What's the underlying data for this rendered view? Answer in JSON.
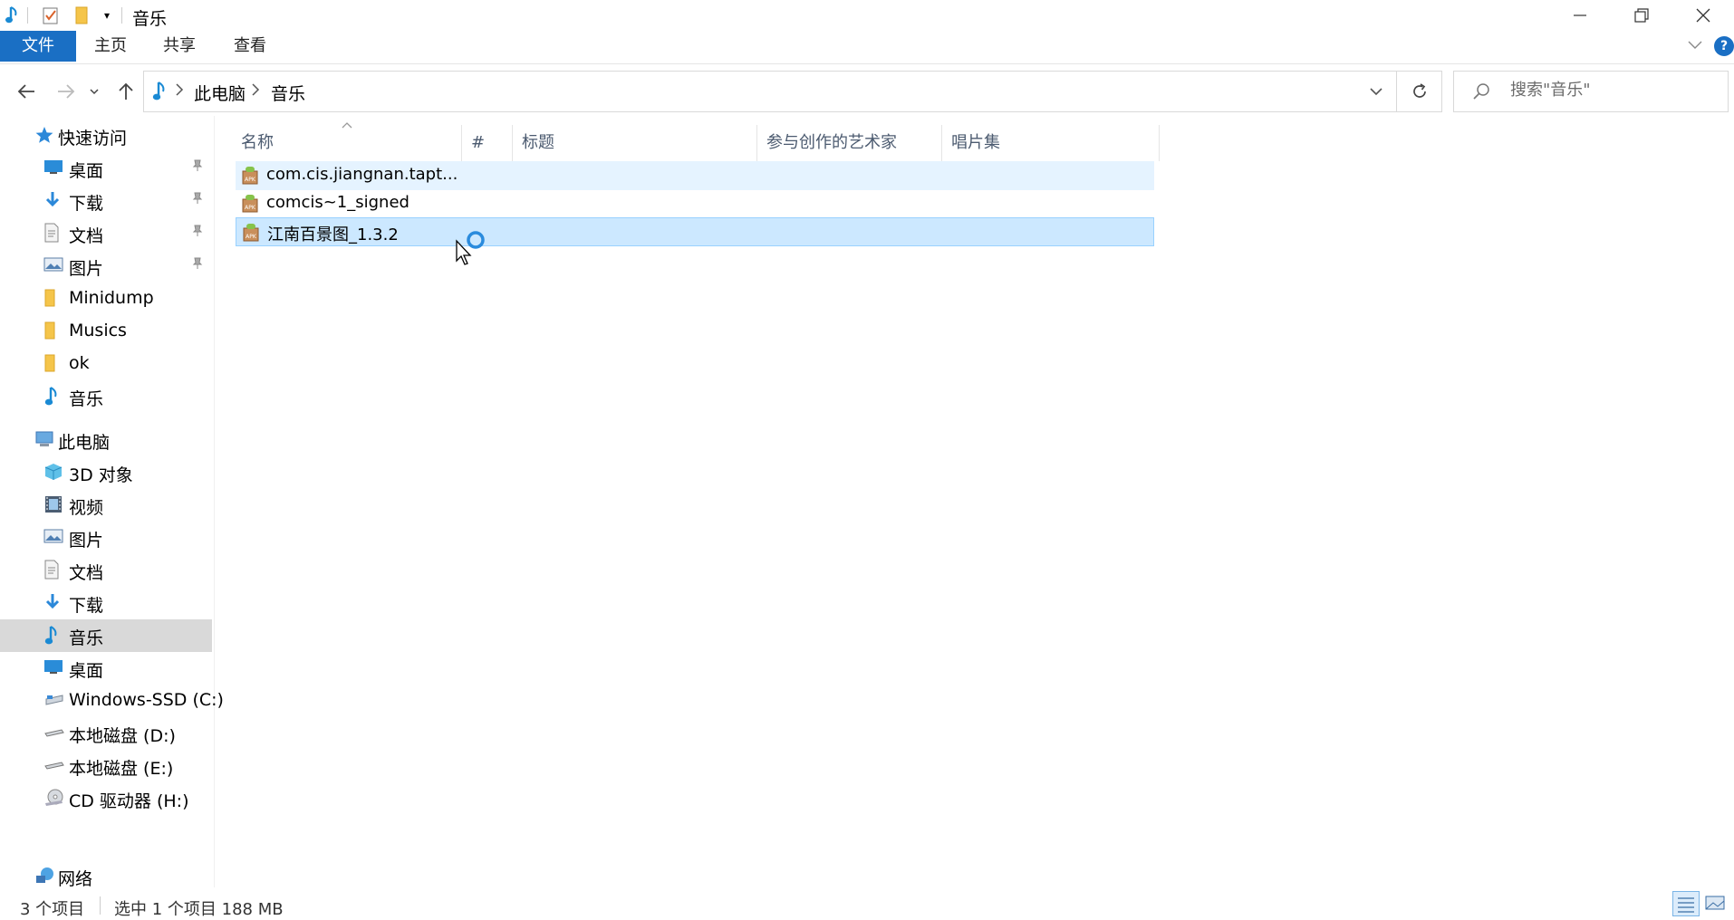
{
  "window": {
    "title": "音乐",
    "controls": [
      "minimize",
      "restore",
      "close"
    ]
  },
  "ribbon": {
    "tabs": [
      "文件",
      "主页",
      "共享",
      "查看"
    ]
  },
  "address": {
    "crumbs": [
      "此电脑",
      "音乐"
    ],
    "search_placeholder": "搜索\"音乐\""
  },
  "nav": {
    "quick_access": "快速访问",
    "quick_items": [
      {
        "label": "桌面",
        "pinned": true
      },
      {
        "label": "下载",
        "pinned": true
      },
      {
        "label": "文档",
        "pinned": true
      },
      {
        "label": "图片",
        "pinned": true
      },
      {
        "label": "Minidump"
      },
      {
        "label": "Musics"
      },
      {
        "label": "ok"
      },
      {
        "label": "音乐"
      }
    ],
    "this_pc": "此电脑",
    "pc_items": [
      {
        "label": "3D 对象"
      },
      {
        "label": "视频"
      },
      {
        "label": "图片"
      },
      {
        "label": "文档"
      },
      {
        "label": "下载"
      },
      {
        "label": "音乐",
        "selected": true
      },
      {
        "label": "桌面"
      },
      {
        "label": "Windows-SSD (C:)"
      },
      {
        "label": "本地磁盘 (D:)"
      },
      {
        "label": "本地磁盘 (E:)"
      },
      {
        "label": "CD 驱动器 (H:)"
      }
    ],
    "network": "网络"
  },
  "columns": [
    "名称",
    "#",
    "标题",
    "参与创作的艺术家",
    "唱片集"
  ],
  "files": [
    {
      "name": "com.cis.jiangnan.tapt...",
      "state": "hover"
    },
    {
      "name": "comcis~1_signed",
      "state": "normal"
    },
    {
      "name": "江南百景图_1.3.2",
      "state": "selected"
    }
  ],
  "status": {
    "count": "3 个项目",
    "selection": "选中 1 个项目  188 MB"
  },
  "colors": {
    "accent": "#1a6fc4",
    "selected_row": "#cce8ff",
    "hover_row": "#e5f3ff",
    "nav_selected": "#d9d9d9"
  }
}
